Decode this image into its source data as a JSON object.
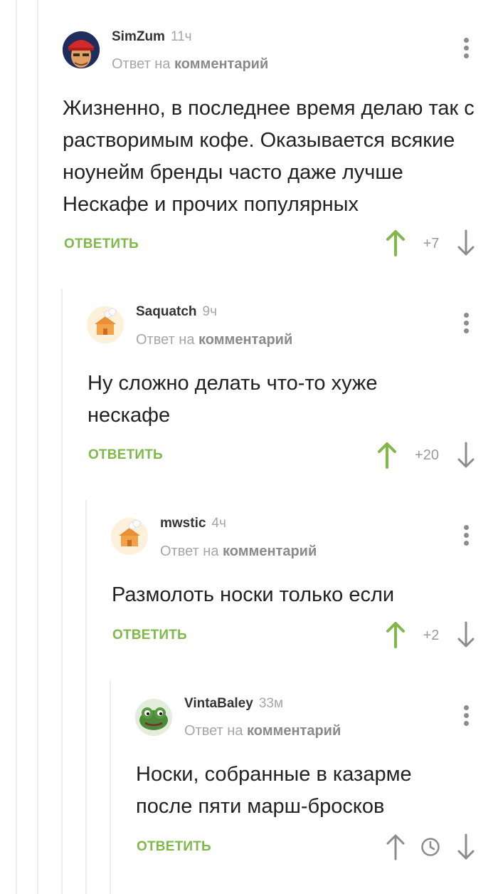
{
  "comments": [
    {
      "author": "SimZum",
      "time": "11ч",
      "reply_prefix": "Ответ на",
      "reply_target": "комментарий",
      "text": "Жизненно, в последнее время делаю так с растворимым кофе. Оказывается всякие ноунейм бренды часто даже лучше Нескафе и прочих популярных",
      "reply_label": "ОТВЕТИТЬ",
      "rating": "+7"
    },
    {
      "author": "Saquatch",
      "time": "9ч",
      "reply_prefix": "Ответ на",
      "reply_target": "комментарий",
      "text": "Ну сложно делать что-то хуже нескафе",
      "reply_label": "ОТВЕТИТЬ",
      "rating": "+20"
    },
    {
      "author": "mwstic",
      "time": "4ч",
      "reply_prefix": "Ответ на",
      "reply_target": "комментарий",
      "text": "Размолоть носки только если",
      "reply_label": "ОТВЕТИТЬ",
      "rating": "+2"
    },
    {
      "author": "VintaBaley",
      "time": "33м",
      "reply_prefix": "Ответ на",
      "reply_target": "комментарий",
      "text": "Носки, собранные в казарме после пяти марш-бросков",
      "reply_label": "ОТВЕТИТЬ",
      "rating_icon": "clock-icon"
    }
  ],
  "colors": {
    "accent": "#7eb94a",
    "muted": "#a6a6a6",
    "thread_line": "#ececec"
  }
}
